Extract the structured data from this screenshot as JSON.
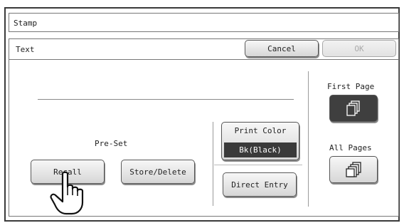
{
  "window": {
    "title": "Stamp"
  },
  "header": {
    "label": "Text",
    "cancel_label": "Cancel",
    "ok_label": "OK"
  },
  "preset": {
    "label": "Pre-Set",
    "recall_label": "Recall",
    "store_delete_label": "Store/Delete"
  },
  "print_color": {
    "label": "Print Color",
    "value": "Bk(Black)"
  },
  "direct_entry_label": "Direct Entry",
  "page_options": {
    "first_page_label": "First Page",
    "all_pages_label": "All Pages",
    "selected": "first_page"
  },
  "icons": {
    "first_page": "stacked-pages-icon",
    "all_pages": "multi-pages-icon",
    "pointer": "hand-pointer-icon"
  }
}
